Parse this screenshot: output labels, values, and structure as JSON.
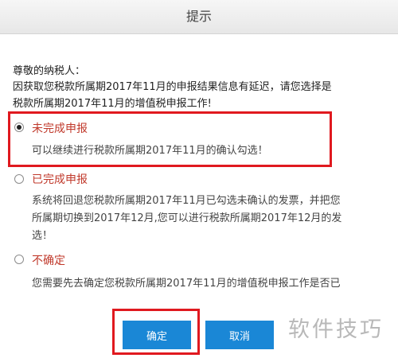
{
  "dialog": {
    "title": "提示",
    "greeting": "尊敬的纳税人：",
    "intro_lines": [
      "因获取您税款所属期2017年11月的申报结果信息有延迟，请您选择是",
      "税款所属期2017年11月的增值税申报工作!"
    ],
    "options": [
      {
        "label": "未完成申报",
        "checked": true,
        "description_lines": [
          "可以继续进行税款所属期2017年11月的确认勾选！"
        ]
      },
      {
        "label": "已完成申报",
        "checked": false,
        "description_lines": [
          "系统将回退您税款所属期2017年11月已勾选未确认的发票，并把您",
          "所属期切换到2017年12月,您可以进行税款所属期2017年12月的发",
          "选！"
        ]
      },
      {
        "label": "不确定",
        "checked": false,
        "description_lines": [
          "您需要先去确定您税款所属期2017年11月的增值税申报工作是否已"
        ]
      }
    ],
    "buttons": {
      "confirm": "确定",
      "cancel": "取消"
    }
  },
  "watermark": "软件技巧",
  "colors": {
    "accent_blue": "#1a87d6",
    "option_label_red": "#c0392b",
    "annotation_red": "#e0191f"
  }
}
